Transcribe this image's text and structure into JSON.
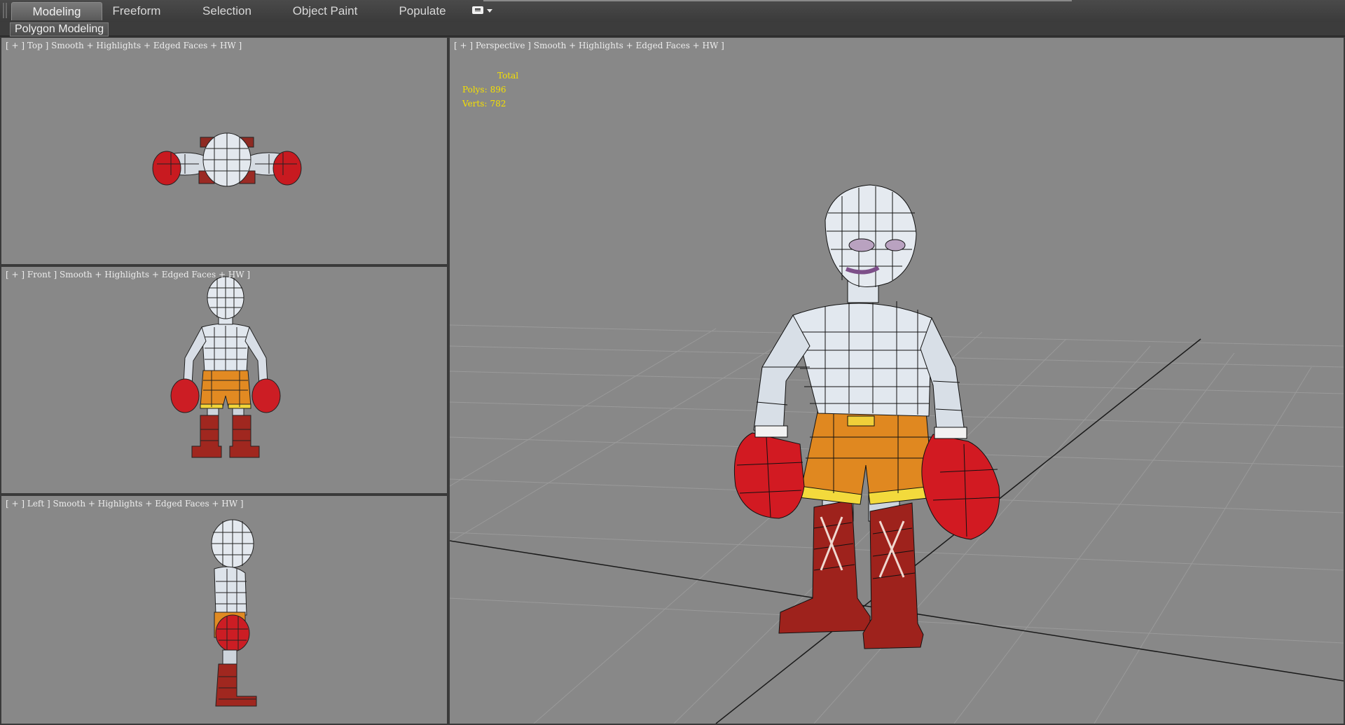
{
  "ribbon": {
    "tabs": [
      {
        "label": "Modeling",
        "active": true
      },
      {
        "label": "Freeform",
        "active": false
      },
      {
        "label": "Selection",
        "active": false
      },
      {
        "label": "Object Paint",
        "active": false
      },
      {
        "label": "Populate",
        "active": false
      }
    ],
    "options_icon": "ribbon-options-icon"
  },
  "subbar": {
    "panel_label": "Polygon Modeling"
  },
  "viewports": {
    "top": {
      "label": "[ + ] Top ] Smooth + Highlights + Edged Faces + HW ]"
    },
    "front": {
      "label": "[ + ] Front ] Smooth + Highlights + Edged Faces + HW ]"
    },
    "left": {
      "label": "[ + ] Left ] Smooth + Highlights + Edged Faces + HW ]"
    },
    "perspective": {
      "label": "[ + ] Perspective ] Smooth + Highlights + Edged Faces + HW ]",
      "stats": {
        "total_label": "Total",
        "polys_label": "Polys:",
        "polys_value": "896",
        "verts_label": "Verts:",
        "verts_value": "782"
      }
    }
  },
  "colors": {
    "viewport_bg": "#888888",
    "stats_text": "#f5e000",
    "glove": "#d81b22",
    "shorts": "#e08a20",
    "boots": "#a52a22",
    "skin": "#dfe6ee"
  }
}
